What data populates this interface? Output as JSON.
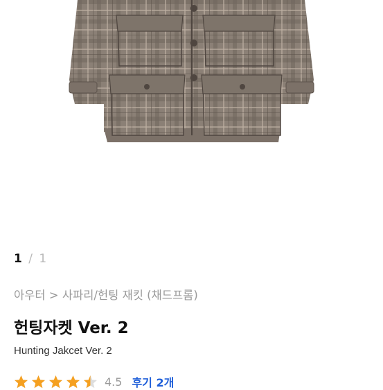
{
  "gallery": {
    "current": "1",
    "separator": "/",
    "total": "1",
    "image_subject": "hunting-jacket-photo"
  },
  "breadcrumb": {
    "parent": "아우터",
    "arrow": ">",
    "category": "사파리/헌팅 재킷 (채드프롬)"
  },
  "product": {
    "title": "헌팅자켓 Ver. 2",
    "subtitle": "Hunting Jakcet Ver. 2"
  },
  "rating": {
    "value": 4.5,
    "max": 5,
    "score_text": "4.5",
    "reviews_text": "후기 2개",
    "star_color": "#f5a020",
    "empty_star_color": "#dddddd"
  },
  "colors": {
    "review_link": "#1f5fd9",
    "jacket_base": "#8a7e72"
  }
}
